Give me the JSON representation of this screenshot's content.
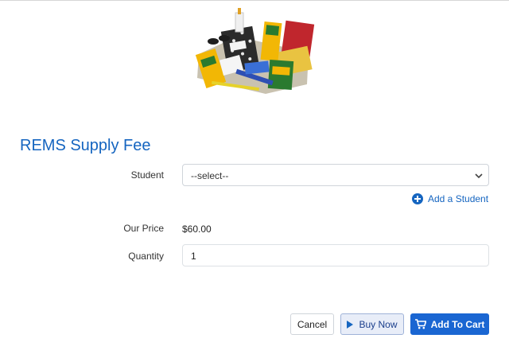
{
  "product": {
    "title": "REMS Supply Fee",
    "image_alt": "school-supplies-image"
  },
  "form": {
    "student_label": "Student",
    "student_select_value": "--select--",
    "add_student_label": "Add a Student",
    "price_label": "Our Price",
    "price_value": "$60.00",
    "quantity_label": "Quantity",
    "quantity_value": "1"
  },
  "actions": {
    "cancel_label": "Cancel",
    "buy_now_label": "Buy Now",
    "add_to_cart_label": "Add To Cart"
  },
  "colors": {
    "accent": "#1565c0",
    "primary_button": "#1a66d2"
  },
  "icons": [
    "chevron-down-icon",
    "plus-circle-icon",
    "play-icon",
    "cart-icon"
  ]
}
